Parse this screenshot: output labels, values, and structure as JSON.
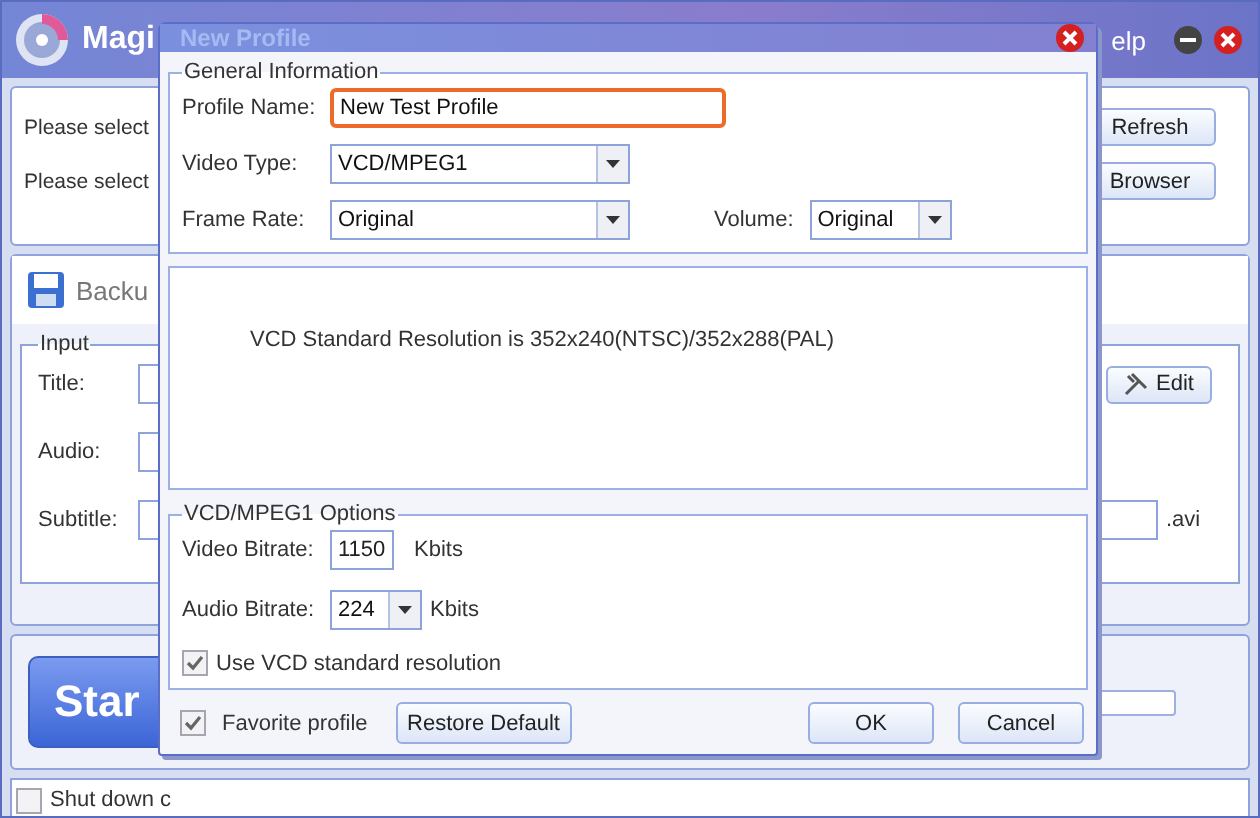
{
  "main_window": {
    "title": "Magi",
    "help_menu": "elp",
    "select_rows": [
      {
        "label": "Please select",
        "button": "Refresh"
      },
      {
        "label": "Please select",
        "button": "Browser"
      }
    ],
    "backup_tab": "Backu",
    "input_group": {
      "legend": "Input",
      "rows": [
        {
          "label": "Title:",
          "button": "Edit"
        },
        {
          "label": "Audio:"
        },
        {
          "label": "Subtitle:",
          "suffix": ".avi"
        }
      ]
    },
    "start_button": "Star",
    "progress": {
      "level": 0
    },
    "shutdown": {
      "label": "Shut down c",
      "checked": false
    }
  },
  "dialog": {
    "title": "New Profile",
    "general": {
      "legend": "General Information",
      "profile_name": {
        "label": "Profile Name:",
        "value": "New Test Profile",
        "highlighted": true
      },
      "video_type": {
        "label": "Video Type:",
        "value": "VCD/MPEG1"
      },
      "frame_rate": {
        "label": "Frame Rate:",
        "value": "Original"
      },
      "volume": {
        "label": "Volume:",
        "value": "Original"
      }
    },
    "resolution_note": "VCD Standard Resolution is 352x240(NTSC)/352x288(PAL)",
    "options": {
      "legend": "VCD/MPEG1 Options",
      "video_bitrate": {
        "label": "Video Bitrate:",
        "value": "1150",
        "unit": "Kbits"
      },
      "audio_bitrate": {
        "label": "Audio Bitrate:",
        "value": "224",
        "unit": "Kbits"
      },
      "use_standard": {
        "label": "Use VCD standard resolution",
        "checked": true
      }
    },
    "favorite": {
      "label": "Favorite profile",
      "checked": true
    },
    "buttons": [
      {
        "label": "Restore Default",
        "kind": "left"
      },
      {
        "label": "OK",
        "kind": "right"
      },
      {
        "label": "Cancel",
        "kind": "right"
      }
    ]
  }
}
